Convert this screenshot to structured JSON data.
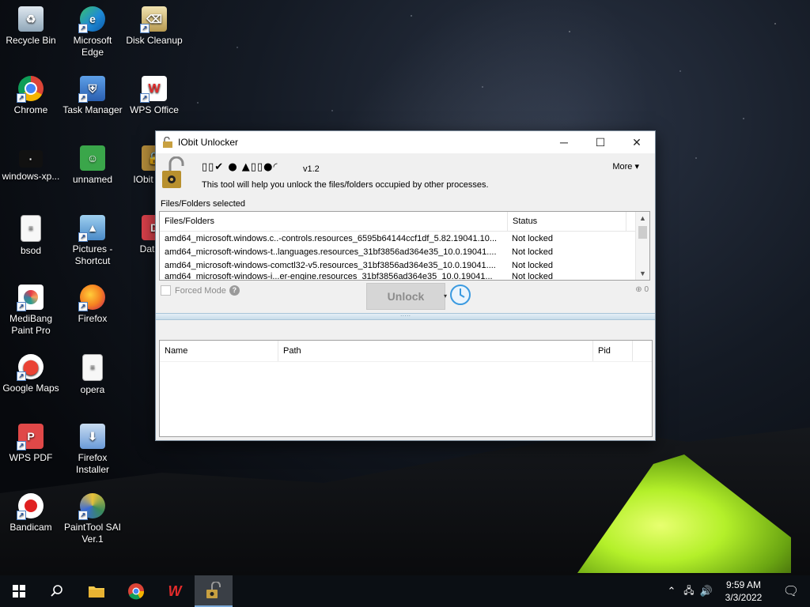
{
  "desktop": {
    "icons": [
      {
        "label": "Recycle Bin",
        "icon": "recycle-bin-icon",
        "color": "#9fb6c8"
      },
      {
        "label": "Microsoft Edge",
        "icon": "edge-icon",
        "color": "#1f8ad6"
      },
      {
        "label": "Disk Cleanup",
        "icon": "disk-cleanup-icon",
        "color": "#d9c48a"
      },
      {
        "label": "Chrome",
        "icon": "chrome-icon",
        "color": "#e44134"
      },
      {
        "label": "Task Manager",
        "icon": "task-manager-icon",
        "color": "#3a7bd5"
      },
      {
        "label": "WPS Office",
        "icon": "wps-office-icon",
        "color": "#e22b2b"
      },
      {
        "label": "windows-xp...",
        "icon": "image-file-icon",
        "color": "#1a1a1a"
      },
      {
        "label": "unnamed",
        "icon": "image-file-icon",
        "color": "#3aa64a"
      },
      {
        "label": "IObit Unlo",
        "icon": "iobit-unlocker-icon",
        "color": "#b38b3a"
      },
      {
        "label": "bsod",
        "icon": "text-file-icon",
        "color": "#f2f2f2"
      },
      {
        "label": "Pictures - Shortcut",
        "icon": "pictures-icon",
        "color": "#6aa8d8"
      },
      {
        "label": "DataW",
        "icon": "datawrapper-icon",
        "color": "#d8404a"
      },
      {
        "label": "MediBang Paint Pro",
        "icon": "medibang-icon",
        "color": "#f5f5f5"
      },
      {
        "label": "Firefox",
        "icon": "firefox-icon",
        "color": "#f58220"
      },
      {
        "label": "Google Maps",
        "icon": "google-maps-icon",
        "color": "#ffffff"
      },
      {
        "label": "opera",
        "icon": "text-file-icon",
        "color": "#f2f2f2"
      },
      {
        "label": "WPS PDF",
        "icon": "wps-pdf-icon",
        "color": "#d83a3a"
      },
      {
        "label": "Firefox Installer",
        "icon": "installer-icon",
        "color": "#6a9ad8"
      },
      {
        "label": "Bandicam",
        "icon": "bandicam-icon",
        "color": "#e02020"
      },
      {
        "label": "PaintTool SAI Ver.1",
        "icon": "painttool-sai-icon",
        "color": "#3a8a5a"
      }
    ]
  },
  "window": {
    "title": "IObit Unlocker",
    "controls": {
      "minimize": "─",
      "maximize": "☐",
      "close": "✕"
    },
    "glyph_banner": "▯▯✔ ● ▲▯▯●◜",
    "version": "v1.2",
    "description": "This tool will help you unlock the files/folders occupied by other processes.",
    "more_label": "More",
    "selected_label": "Files/Folders selected",
    "files_table": {
      "headers": [
        "Files/Folders",
        "Status"
      ],
      "rows": [
        {
          "file": "amd64_microsoft.windows.c..-controls.resources_6595b64144ccf1df_5.82.19041.10...",
          "status": "Not locked"
        },
        {
          "file": "amd64_microsoft-windows-t..languages.resources_31bf3856ad364e35_10.0.19041....",
          "status": "Not locked"
        },
        {
          "file": "amd64_microsoft-windows-comctl32-v5.resources_31bf3856ad364e35_10.0.19041....",
          "status": "Not locked"
        },
        {
          "file": "amd64_microsoft-windows-i...er-engine.resources_31bf3856ad364e35_10.0.19041...",
          "status": "Not locked"
        }
      ]
    },
    "forced_mode_label": "Forced Mode",
    "unlock_label": "Unlock",
    "zoom_label": "⊕ 0",
    "process_table": {
      "headers": [
        "Name",
        "Path",
        "Pid"
      ]
    }
  },
  "taskbar": {
    "time": "9:59 AM",
    "date": "3/3/2022",
    "tray_icons": [
      "chevron-up-icon",
      "network-icon",
      "volume-icon"
    ]
  }
}
